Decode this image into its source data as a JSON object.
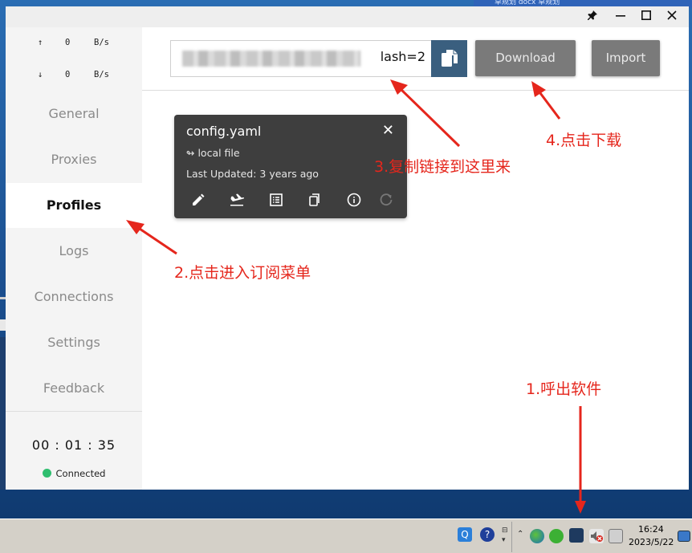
{
  "background": {
    "doc_tab_text": "草规划 docx  草规划"
  },
  "window": {
    "controls": {
      "pin": "📌",
      "minimize": "—",
      "maximize": "☐",
      "close": "✕"
    }
  },
  "sidebar": {
    "upload": {
      "arrow": "↑",
      "value": "0",
      "unit": "B/s"
    },
    "download": {
      "arrow": "↓",
      "value": "0",
      "unit": "B/s"
    },
    "items": [
      {
        "label": "General",
        "active": false
      },
      {
        "label": "Proxies",
        "active": false
      },
      {
        "label": "Profiles",
        "active": true
      },
      {
        "label": "Logs",
        "active": false
      },
      {
        "label": "Connections",
        "active": false
      },
      {
        "label": "Settings",
        "active": false
      },
      {
        "label": "Feedback",
        "active": false
      }
    ],
    "timer": "00 : 01 : 35",
    "status": "Connected",
    "status_color": "#2fbe6f"
  },
  "toolbar": {
    "url_value": "lash=2",
    "download_label": "Download",
    "import_label": "Import",
    "copy_button_color": "#3a5f7f"
  },
  "profile_card": {
    "title": "config.yaml",
    "close": "✕",
    "type": "↬ local file",
    "updated_label": "Last Updated: ",
    "updated_value": "3 years ago"
  },
  "annotations": {
    "step1": "1.呼出软件",
    "step2": "2.点击进入订阅菜单",
    "step3": "3.复制链接到这里来",
    "step4": "4.点击下载",
    "color": "#e5261c"
  },
  "taskbar": {
    "time": "16:24",
    "date": "2023/5/22"
  }
}
